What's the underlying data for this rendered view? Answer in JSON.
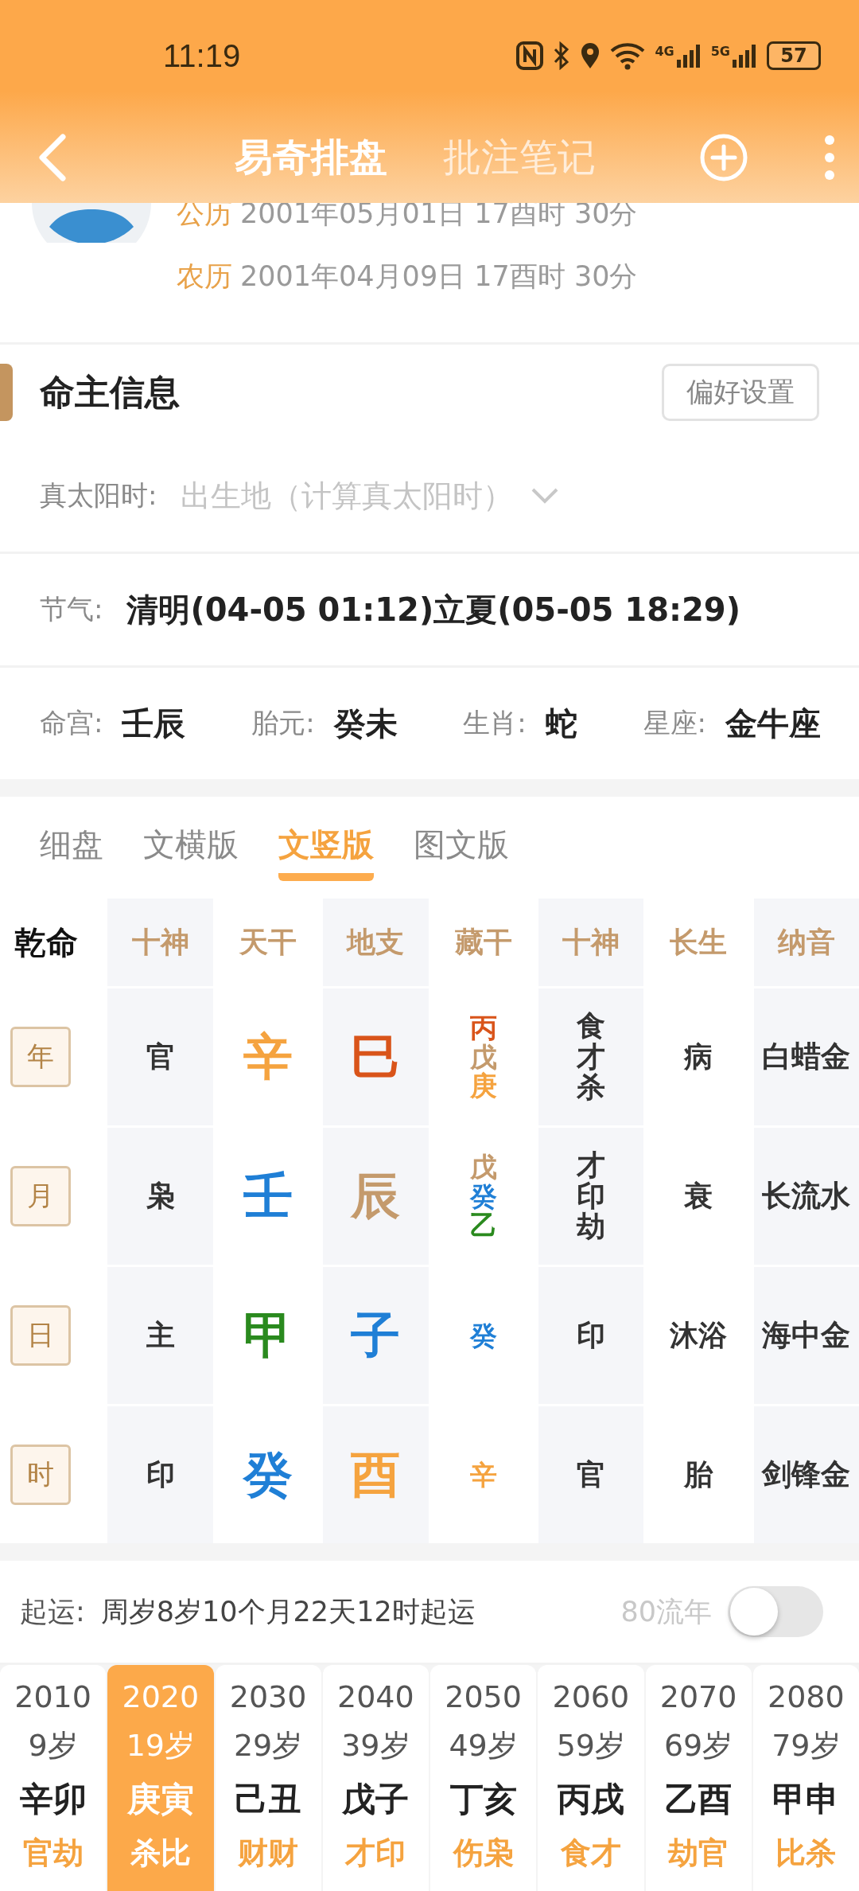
{
  "status_bar": {
    "time": "11:19",
    "network_labels": [
      "4G",
      "5G"
    ],
    "battery": "57"
  },
  "header": {
    "tabs": [
      {
        "label": "易奇排盘",
        "selected": true
      },
      {
        "label": "批注笔记",
        "selected": false
      }
    ]
  },
  "profile": {
    "dates": [
      {
        "label": "公历",
        "value": "2001年05月01日 17酉时 30分"
      },
      {
        "label": "农历",
        "value": "2001年04月09日 17酉时 30分"
      }
    ]
  },
  "owner_info": {
    "title": "命主信息",
    "settings_button": "偏好设置",
    "solar_time": {
      "label": "真太阳时:",
      "placeholder": "出生地（计算真太阳时）"
    },
    "solar_terms": {
      "label": "节气:",
      "value": "清明(04-05 01:12)立夏(05-05 18:29)"
    },
    "facts": [
      {
        "label": "命宫:",
        "value": "壬辰"
      },
      {
        "label": "胎元:",
        "value": "癸未"
      },
      {
        "label": "生肖:",
        "value": "蛇"
      },
      {
        "label": "星座:",
        "value": "金牛座"
      }
    ]
  },
  "view_tabs": [
    {
      "label": "细盘",
      "selected": false
    },
    {
      "label": "文横版",
      "selected": false
    },
    {
      "label": "文竖版",
      "selected": true
    },
    {
      "label": "图文版",
      "selected": false
    }
  ],
  "chart_table": {
    "corner": "乾命",
    "columns": [
      "十神",
      "天干",
      "地支",
      "藏干",
      "十神",
      "长生",
      "纳音"
    ],
    "rows": [
      {
        "pillar": "年",
        "ten_god": "官",
        "stem": {
          "text": "辛",
          "color": "#f5a33f"
        },
        "branch": {
          "text": "巳",
          "color": "#d9541a"
        },
        "hidden_stems": [
          {
            "text": "丙",
            "color": "#d9541a"
          },
          {
            "text": "戊",
            "color": "#c49a6c"
          },
          {
            "text": "庚",
            "color": "#f5a33f"
          }
        ],
        "hidden_gods": [
          "食",
          "才",
          "杀"
        ],
        "growth": "病",
        "nayin": "白蜡金"
      },
      {
        "pillar": "月",
        "ten_god": "枭",
        "stem": {
          "text": "壬",
          "color": "#1f7fd6"
        },
        "branch": {
          "text": "辰",
          "color": "#c49a6c"
        },
        "hidden_stems": [
          {
            "text": "戊",
            "color": "#c49a6c"
          },
          {
            "text": "癸",
            "color": "#1f7fd6"
          },
          {
            "text": "乙",
            "color": "#2a8a1e"
          }
        ],
        "hidden_gods": [
          "才",
          "印",
          "劫"
        ],
        "growth": "衰",
        "nayin": "长流水"
      },
      {
        "pillar": "日",
        "ten_god": "主",
        "stem": {
          "text": "甲",
          "color": "#2a8a1e"
        },
        "branch": {
          "text": "子",
          "color": "#1f7fd6"
        },
        "hidden_stems": [
          {
            "text": "癸",
            "color": "#1f7fd6"
          }
        ],
        "hidden_gods": [
          "印"
        ],
        "growth": "沐浴",
        "nayin": "海中金"
      },
      {
        "pillar": "时",
        "ten_god": "印",
        "stem": {
          "text": "癸",
          "color": "#1f7fd6"
        },
        "branch": {
          "text": "酉",
          "color": "#f5a33f"
        },
        "hidden_stems": [
          {
            "text": "辛",
            "color": "#f5a33f"
          }
        ],
        "hidden_gods": [
          "官"
        ],
        "growth": "胎",
        "nayin": "剑锋金"
      }
    ]
  },
  "luck": {
    "label": "起运:",
    "start": "周岁8岁10个月22天12时起运",
    "toggle": {
      "label": "80流年",
      "on": false
    },
    "periods": [
      {
        "year": "2010",
        "age": "9岁",
        "ganzhi": "辛卯",
        "gods": "官劫",
        "selected": false
      },
      {
        "year": "2020",
        "age": "19岁",
        "ganzhi": "庚寅",
        "gods": "杀比",
        "selected": true
      },
      {
        "year": "2030",
        "age": "29岁",
        "ganzhi": "己丑",
        "gods": "财财",
        "selected": false
      },
      {
        "year": "2040",
        "age": "39岁",
        "ganzhi": "戊子",
        "gods": "才印",
        "selected": false
      },
      {
        "year": "2050",
        "age": "49岁",
        "ganzhi": "丁亥",
        "gods": "伤枭",
        "selected": false
      },
      {
        "year": "2060",
        "age": "59岁",
        "ganzhi": "丙戌",
        "gods": "食才",
        "selected": false
      },
      {
        "year": "2070",
        "age": "69岁",
        "ganzhi": "乙酉",
        "gods": "劫官",
        "selected": false
      },
      {
        "year": "2080",
        "age": "79岁",
        "ganzhi": "甲申",
        "gods": "比杀",
        "selected": false
      }
    ]
  }
}
